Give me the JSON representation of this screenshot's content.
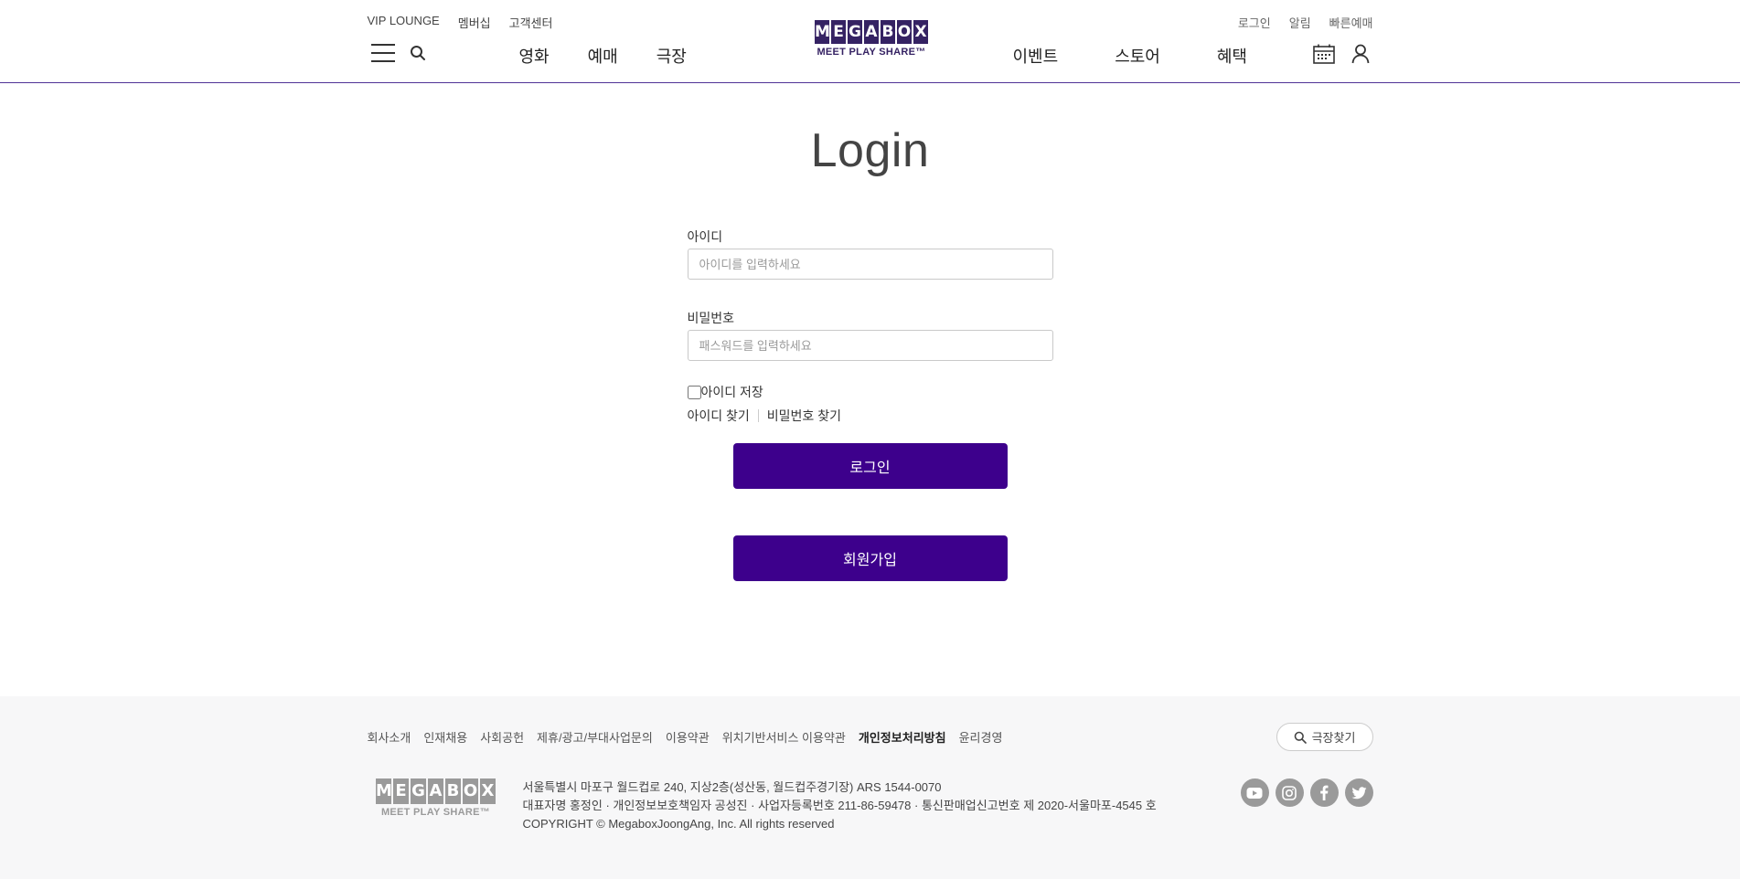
{
  "header": {
    "util_left": [
      "VIP LOUNGE",
      "멤버십",
      "고객센터"
    ],
    "util_right": [
      "로그인",
      "알림",
      "빠른예매"
    ],
    "gnb_left": [
      "영화",
      "예매",
      "극장"
    ],
    "gnb_right": [
      "이벤트",
      "스토어",
      "혜택"
    ],
    "logo": {
      "letters": [
        "M",
        "E",
        "G",
        "A",
        "B",
        "O",
        "X"
      ],
      "tagline": "MEET PLAY SHARE™"
    }
  },
  "login": {
    "title": "Login",
    "id_label": "아이디",
    "id_placeholder": "아이디를 입력하세요",
    "id_value": "",
    "pw_label": "비밀번호",
    "pw_placeholder": "패스워드를 입력하세요",
    "pw_value": "",
    "save_id_label": "아이디 저장",
    "save_id_checked": false,
    "find_id": "아이디 찾기",
    "find_pw": "비밀번호 찾기",
    "login_button": "로그인",
    "join_button": "회원가입"
  },
  "footer": {
    "links": [
      "회사소개",
      "인재채용",
      "사회공헌",
      "제휴/광고/부대사업문의",
      "이용약관",
      "위치기반서비스 이용약관",
      "개인정보처리방침",
      "윤리경영"
    ],
    "bold_link_index": 6,
    "theater_search": "극장찾기",
    "logo_tagline": "MEET PLAY SHARE™",
    "info_lines": [
      "서울특별시 마포구 월드컵로 240, 지상2층(성산동, 월드컵주경기장) ARS 1544-0070",
      "대표자명 홍정인 · 개인정보보호책임자 공성진 · 사업자등록번호 211-86-59478 · 통신판매업신고번호 제 2020-서울마포-4545 호",
      "COPYRIGHT © MegaboxJoongAng, Inc. All rights reserved"
    ],
    "sns": [
      "youtube-icon",
      "instagram-icon",
      "facebook-icon",
      "twitter-icon"
    ]
  },
  "colors": {
    "brand": "#352263",
    "button": "#3d008c",
    "footer_bg": "#f7f7f8"
  }
}
